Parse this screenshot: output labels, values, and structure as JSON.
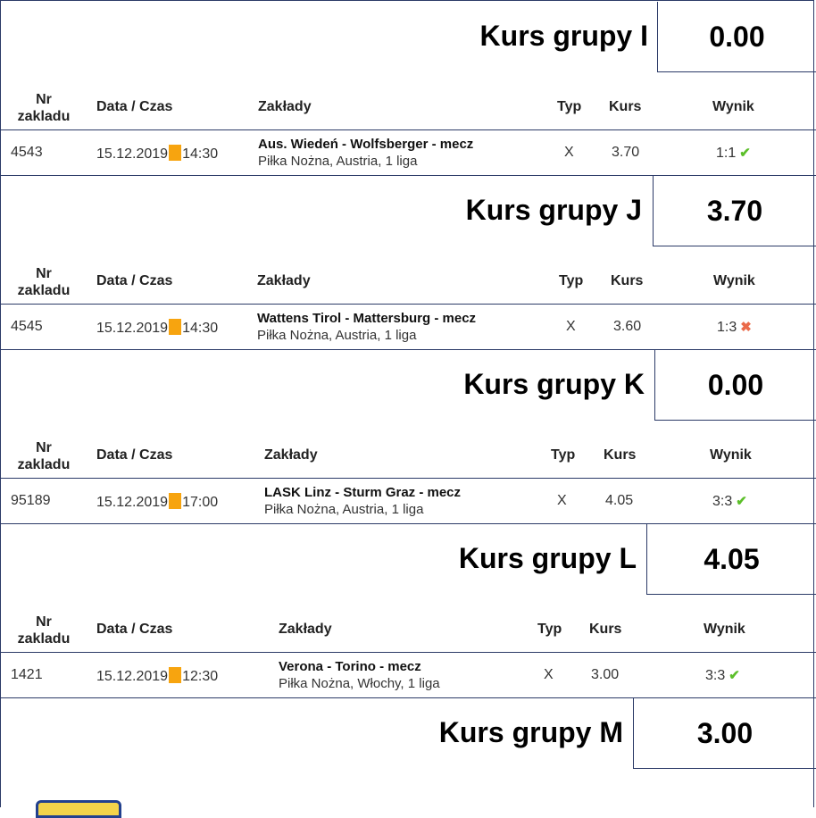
{
  "headers": {
    "nr_line1": "Nr",
    "nr_line2": "zakladu",
    "date": "Data / Czas",
    "bets": "Zakłady",
    "type": "Typ",
    "odds": "Kurs",
    "result": "Wynik"
  },
  "groups": [
    {
      "title": "Kurs grupy I",
      "value": "0.00"
    },
    {
      "title": "Kurs grupy J",
      "value": "3.70"
    },
    {
      "title": "Kurs grupy K",
      "value": "0.00"
    },
    {
      "title": "Kurs grupy L",
      "value": "4.05"
    },
    {
      "title": "Kurs grupy M",
      "value": "3.00"
    }
  ],
  "bets": [
    {
      "nr": "4543",
      "date": "15.12.2019",
      "time": "14:30",
      "match": "Aus. Wiedeń - Wolfsberger - mecz",
      "league": "Piłka Nożna, Austria, 1 liga",
      "type": "X",
      "odds": "3.70",
      "result": "1:1",
      "status": "win",
      "status_icon": "check-icon"
    },
    {
      "nr": "4545",
      "date": "15.12.2019",
      "time": "14:30",
      "match": "Wattens Tirol - Mattersburg - mecz",
      "league": "Piłka Nożna, Austria, 1 liga",
      "type": "X",
      "odds": "3.60",
      "result": "1:3",
      "status": "loss",
      "status_icon": "cross-icon"
    },
    {
      "nr": "95189",
      "date": "15.12.2019",
      "time": "17:00",
      "match": "LASK Linz - Sturm Graz - mecz",
      "league": "Piłka Nożna, Austria, 1 liga",
      "type": "X",
      "odds": "4.05",
      "result": "3:3",
      "status": "win",
      "status_icon": "check-icon"
    },
    {
      "nr": "1421",
      "date": "15.12.2019",
      "time": "12:30",
      "match": "Verona - Torino - mecz",
      "league": "Piłka Nożna, Włochy, 1 liga",
      "type": "X",
      "odds": "3.00",
      "result": "3:3",
      "status": "win",
      "status_icon": "check-icon"
    }
  ],
  "colors": {
    "border": "#2b3a67",
    "time_marker": "#f7a40f",
    "win": "#5cbf2a",
    "loss": "#ea6b4b"
  }
}
